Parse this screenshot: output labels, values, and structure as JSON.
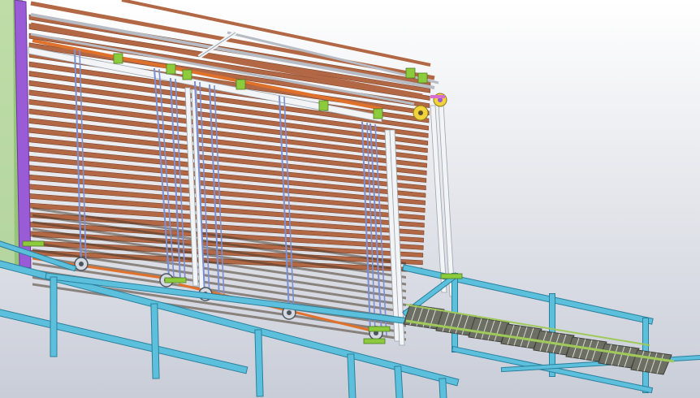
{
  "viewport": {
    "background_top": "#ffffff",
    "background_bottom": "#c9cdd8"
  },
  "model": {
    "subject": "cad-assembly-vertical-rack-with-conveyor",
    "colors": {
      "slat": "#b26745",
      "slat_dark": "#7a4328",
      "frame_cyan": "#5cc0dc",
      "frame_cyan_dark": "#2b7f9c",
      "guide_white": "#f2f4f6",
      "guide_shadow": "#9aa3ad",
      "purple_post": "#9a5bd6",
      "green_panel": "#a8d28a",
      "green_bracket": "#8ccc3c",
      "chain_blue": "#7a8fd6",
      "orange_rod": "#e0712b",
      "pulley_yellow": "#f1d23a",
      "tray_grey": "#6d6f64",
      "tray_green": "#9fca5a",
      "chain_grey": "#b7bcc4"
    }
  }
}
